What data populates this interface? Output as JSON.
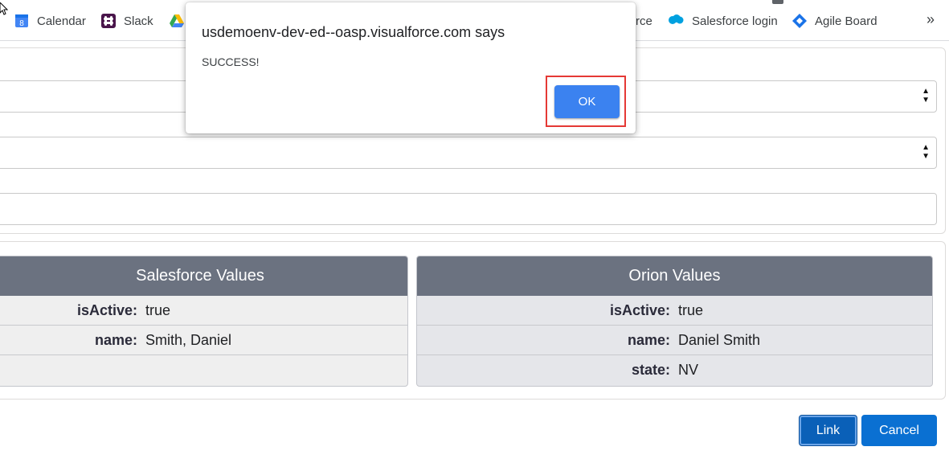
{
  "bookmarks": {
    "items": [
      {
        "label": "Calendar",
        "icon": "calendar-icon"
      },
      {
        "label": "Slack",
        "icon": "slack-icon"
      },
      {
        "label": "",
        "icon": "google-drive-icon"
      },
      {
        "label": "rce",
        "icon": ""
      },
      {
        "label": "Salesforce login",
        "icon": "salesforce-icon"
      },
      {
        "label": "Agile Board",
        "icon": "diamond-icon"
      }
    ],
    "overflow": "»"
  },
  "dialog": {
    "title": "usdemoenv-dev-ed--oasp.visualforce.com says",
    "message": "SUCCESS!",
    "ok_label": "OK"
  },
  "salesforce_table": {
    "header": "Salesforce Values",
    "rows": [
      {
        "key": "isActive:",
        "value": "true"
      },
      {
        "key": "name:",
        "value": "Smith, Daniel"
      },
      {
        "key": "",
        "value": ""
      }
    ]
  },
  "orion_table": {
    "header": "Orion Values",
    "rows": [
      {
        "key": "isActive:",
        "value": "true"
      },
      {
        "key": "name:",
        "value": "Daniel Smith"
      },
      {
        "key": "state:",
        "value": "NV"
      }
    ]
  },
  "actions": {
    "link_label": "Link",
    "cancel_label": "Cancel"
  },
  "colors": {
    "accent": "#0a70d2",
    "header": "#6b7280",
    "highlight": "#e53935"
  }
}
